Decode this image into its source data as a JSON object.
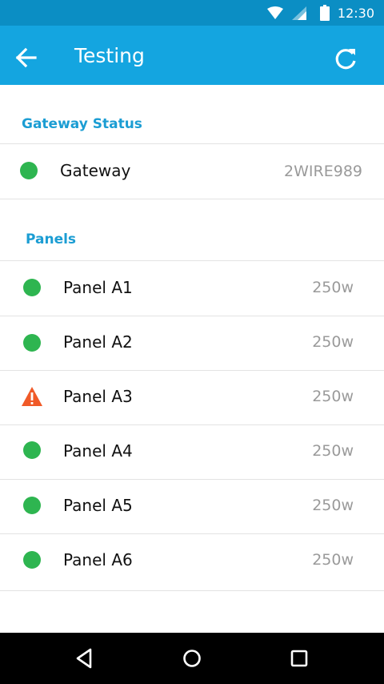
{
  "status_bar": {
    "time": "12:30",
    "icons": [
      "wifi-icon",
      "signal-icon",
      "battery-icon"
    ]
  },
  "app_bar": {
    "title": "Testing",
    "back_icon": "arrow-back-icon",
    "refresh_icon": "refresh-icon"
  },
  "gateway_section": {
    "header": "Gateway Status",
    "items": [
      {
        "label": "Gateway",
        "value": "2WIRE989",
        "status": "ok"
      }
    ]
  },
  "panels_section": {
    "header": "Panels",
    "items": [
      {
        "label": "Panel A1",
        "value": "250w",
        "status": "ok"
      },
      {
        "label": "Panel A2",
        "value": "250w",
        "status": "ok"
      },
      {
        "label": "Panel A3",
        "value": "250w",
        "status": "warning"
      },
      {
        "label": "Panel A4",
        "value": "250w",
        "status": "ok"
      },
      {
        "label": "Panel A5",
        "value": "250w",
        "status": "ok"
      },
      {
        "label": "Panel A6",
        "value": "250w",
        "status": "ok"
      }
    ]
  },
  "colors": {
    "app_bar": "#14a5e0",
    "status_bar": "#0b8ec4",
    "section_header": "#1b9dd3",
    "status_ok": "#2eb550",
    "status_warning": "#f05a28"
  },
  "nav_bar": {
    "icons": [
      "back-triangle-icon",
      "home-circle-icon",
      "recents-square-icon"
    ]
  }
}
